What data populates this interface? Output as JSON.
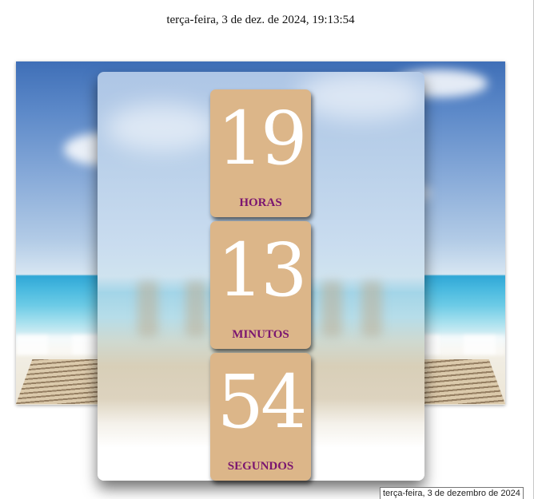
{
  "header": {
    "datetime": "terça-feira, 3 de dez. de 2024, 19:13:54"
  },
  "clock": {
    "hours": {
      "value": "19",
      "label": "HORAS"
    },
    "minutes": {
      "value": "13",
      "label": "MINUTOS"
    },
    "seconds": {
      "value": "54",
      "label": "SEGUNDOS"
    }
  },
  "tooltip": {
    "text": "terça-feira, 3 de dezembro de 2024"
  },
  "colors": {
    "tile": "#dcb689",
    "label": "#7a1570",
    "digit": "#ffffff"
  }
}
